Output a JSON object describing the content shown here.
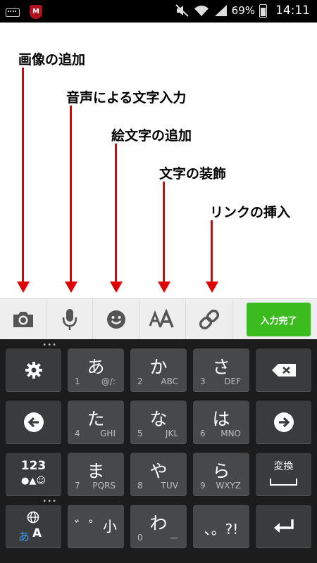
{
  "status_bar": {
    "battery_percent": "69%",
    "time": "14:11",
    "left_icons": [
      "keyboard-indicator-icon",
      "mcafee-icon"
    ],
    "right_icons": [
      "mute-icon",
      "wifi-icon",
      "signal-icon",
      "battery-icon"
    ]
  },
  "annotations": [
    {
      "label": "画像の追加"
    },
    {
      "label": "音声による文字入力"
    },
    {
      "label": "絵文字の追加"
    },
    {
      "label": "文字の装飾"
    },
    {
      "label": "リンクの挿入"
    }
  ],
  "toolbar": {
    "buttons": [
      "camera-icon",
      "microphone-icon",
      "emoji-icon",
      "text-decoration-icon",
      "link-icon"
    ],
    "done_label": "入力完了",
    "done_color": "#3bbb1e"
  },
  "keyboard": {
    "row1": [
      {
        "icon": "settings-icon"
      },
      {
        "main": "あ",
        "num": "1",
        "sub": "@/:"
      },
      {
        "main": "か",
        "num": "2",
        "sub": "ABC"
      },
      {
        "main": "さ",
        "num": "3",
        "sub": "DEF"
      },
      {
        "icon": "backspace-icon"
      }
    ],
    "row2": [
      {
        "icon": "arrow-left-icon"
      },
      {
        "main": "た",
        "num": "4",
        "sub": "GHI"
      },
      {
        "main": "な",
        "num": "5",
        "sub": "JKL"
      },
      {
        "main": "は",
        "num": "6",
        "sub": "MNO"
      },
      {
        "icon": "arrow-right-icon"
      }
    ],
    "row3": [
      {
        "top": "123",
        "bottom": "●▲☺"
      },
      {
        "main": "ま",
        "num": "7",
        "sub": "PQRS"
      },
      {
        "main": "や",
        "num": "8",
        "sub": "TUV"
      },
      {
        "main": "ら",
        "num": "9",
        "sub": "WXYZ"
      },
      {
        "top": "変換"
      }
    ],
    "row4": [
      {
        "hira": "あ",
        "latin": "A",
        "icon": "globe-icon"
      },
      {
        "main": "゛゜小"
      },
      {
        "main": "わ",
        "num": "0",
        "sub": "—"
      },
      {
        "main": "、。?!"
      },
      {
        "icon": "enter-icon"
      }
    ]
  }
}
